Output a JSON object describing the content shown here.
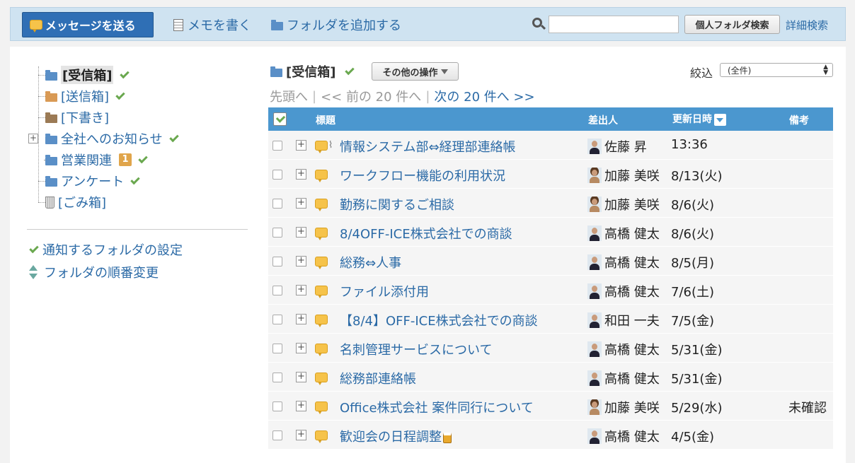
{
  "toolbar": {
    "send_label": "メッセージを送る",
    "memo_label": "メモを書く",
    "add_folder_label": "フォルダを追加する",
    "search_placeholder": "",
    "search_button_label": "個人フォルダ検索",
    "advanced_search_label": "詳細検索"
  },
  "sidebar": {
    "folders": [
      {
        "label": "[受信箱]",
        "check": true,
        "selected": true,
        "icon": "folder-blue"
      },
      {
        "label": "[送信箱]",
        "check": true,
        "icon": "folder-orange"
      },
      {
        "label": "[下書き]",
        "check": false,
        "icon": "folder-brown"
      },
      {
        "label": "全社へのお知らせ",
        "check": true,
        "icon": "folder-blue",
        "expandable": true
      },
      {
        "label": "営業関連",
        "check": true,
        "badge": "1",
        "icon": "folder-blue"
      },
      {
        "label": "アンケート",
        "check": true,
        "icon": "folder-blue"
      },
      {
        "label": "[ごみ箱]",
        "check": false,
        "icon": "trash"
      }
    ],
    "links": [
      {
        "label": "通知するフォルダの設定",
        "icon": "check-icon"
      },
      {
        "label": "フォルダの順番変更",
        "icon": "updown-arrows-icon"
      }
    ]
  },
  "main": {
    "folder_title": "[受信箱]",
    "ops_button_label": "その他の操作",
    "filter_label": "絞込",
    "filter_value": "(全件)",
    "pager": {
      "first": "先頭へ",
      "prev": "<< 前の 20 件へ",
      "next": "次の 20 件へ >>"
    },
    "columns": {
      "subject": "標題",
      "sender": "差出人",
      "updated": "更新日時",
      "note": "備考"
    },
    "rows": [
      {
        "subject": "情報システム部⇔経理部連絡帳",
        "sender": "佐藤 昇",
        "date": "13:36",
        "note": "",
        "attachment": true,
        "avatar": "m"
      },
      {
        "subject": "ワークフロー機能の利用状況",
        "sender": "加藤 美咲",
        "date": "8/13(火)",
        "note": "",
        "avatar": "f"
      },
      {
        "subject": "勤務に関するご相談",
        "sender": "加藤 美咲",
        "date": "8/6(火)",
        "note": "",
        "avatar": "f"
      },
      {
        "subject": "8/4OFF-ICE株式会社での商談",
        "sender": "高橋 健太",
        "date": "8/6(火)",
        "note": "",
        "avatar": "m"
      },
      {
        "subject": "総務⇔人事",
        "sender": "高橋 健太",
        "date": "8/5(月)",
        "note": "",
        "avatar": "m"
      },
      {
        "subject": "ファイル添付用",
        "sender": "高橋 健太",
        "date": "7/6(土)",
        "note": "",
        "avatar": "m"
      },
      {
        "subject": "【8/4】OFF-ICE株式会社での商談",
        "sender": "和田 一夫",
        "date": "7/5(金)",
        "note": "",
        "avatar": "m"
      },
      {
        "subject": "名刺管理サービスについて",
        "sender": "高橋 健太",
        "date": "5/31(金)",
        "note": "",
        "avatar": "m"
      },
      {
        "subject": "総務部連絡帳",
        "sender": "高橋 健太",
        "date": "5/31(金)",
        "note": "",
        "avatar": "m"
      },
      {
        "subject": "Office株式会社 案件同行について",
        "sender": "加藤 美咲",
        "date": "5/29(水)",
        "note": "未確認",
        "avatar": "f"
      },
      {
        "subject": "歓迎会の日程調整",
        "sender": "高橋 健太",
        "date": "4/5(金)",
        "note": "",
        "avatar": "m",
        "beer": true
      }
    ]
  }
}
